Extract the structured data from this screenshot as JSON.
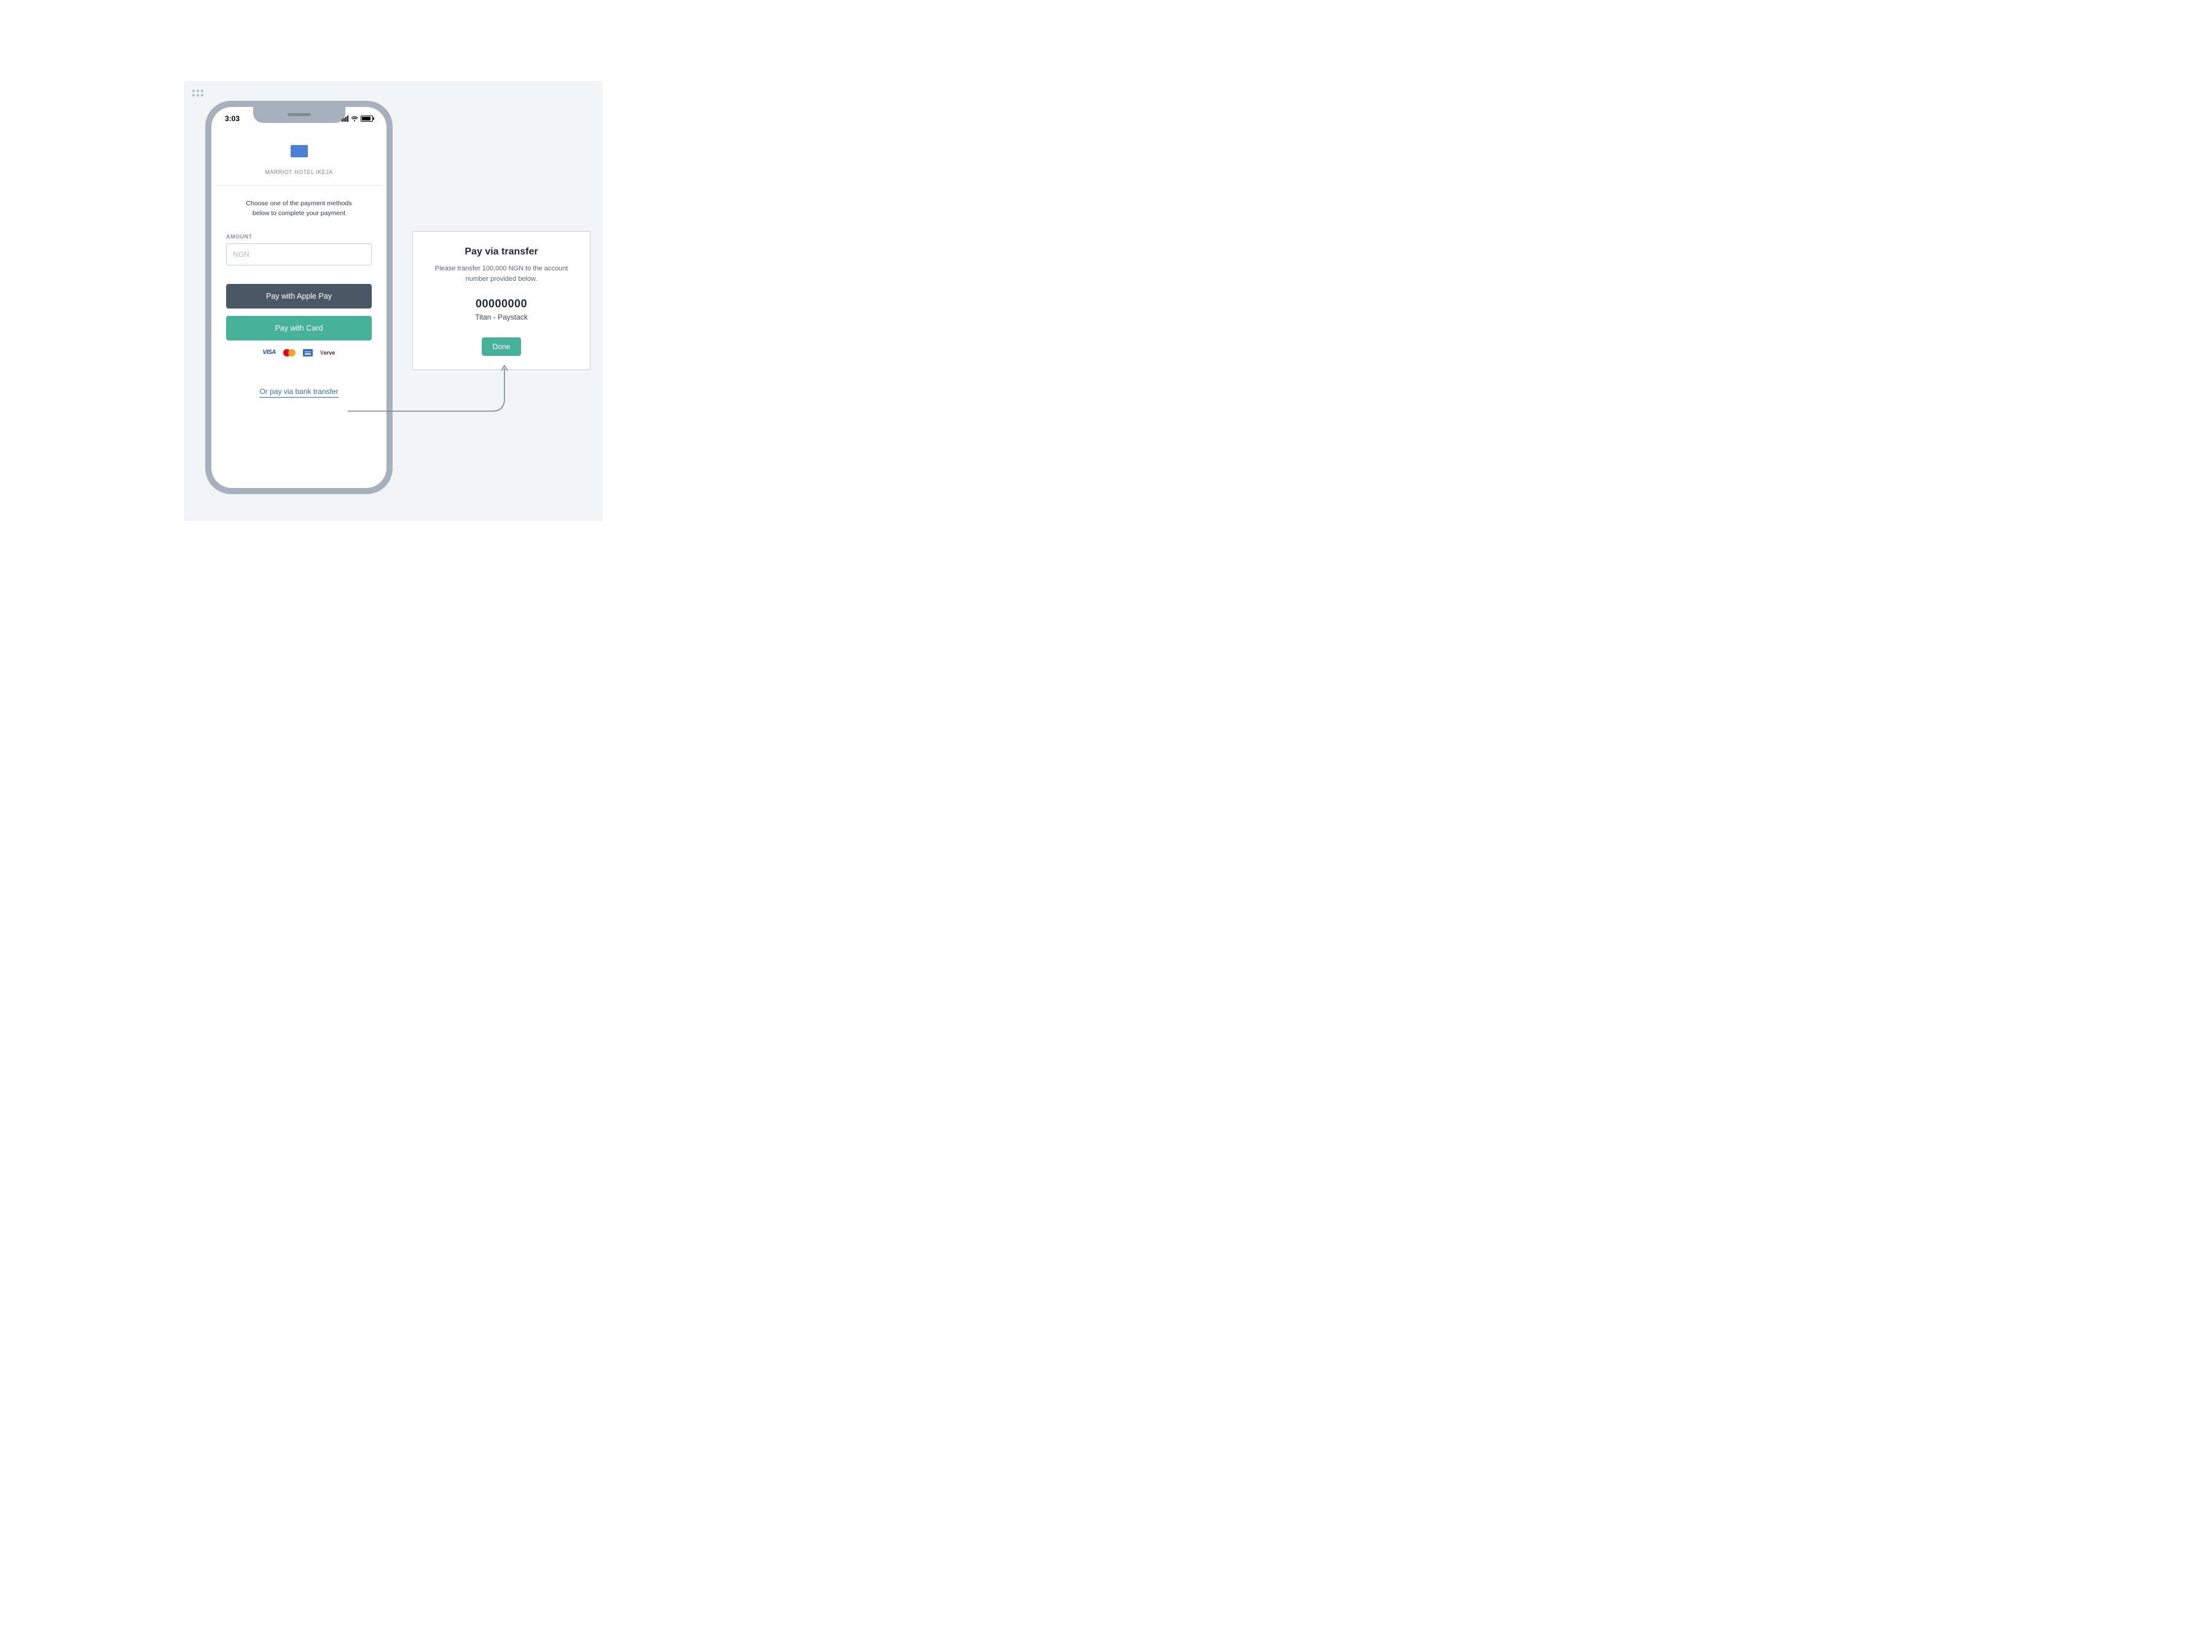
{
  "status": {
    "time": "3:03"
  },
  "merchant": {
    "name": "MARRIOT HOTEL IKEJA"
  },
  "instruction": {
    "line1": "Choose one of the payment methods",
    "line2": "below to complete your payment"
  },
  "amount": {
    "label": "AMOUNT",
    "placeholder": "NGN"
  },
  "buttons": {
    "apple_pay": "Pay with Apple Pay",
    "card": "Pay with Card"
  },
  "card_brands": {
    "visa": "VISA",
    "verve": "Verve"
  },
  "transfer_link": "Or pay via bank transfer",
  "modal": {
    "title": "Pay via transfer",
    "description": "Please transfer 100,000 NGN to the account number provided below.",
    "account_number": "00000000",
    "bank": "Titan - Paystack",
    "done": "Done"
  }
}
